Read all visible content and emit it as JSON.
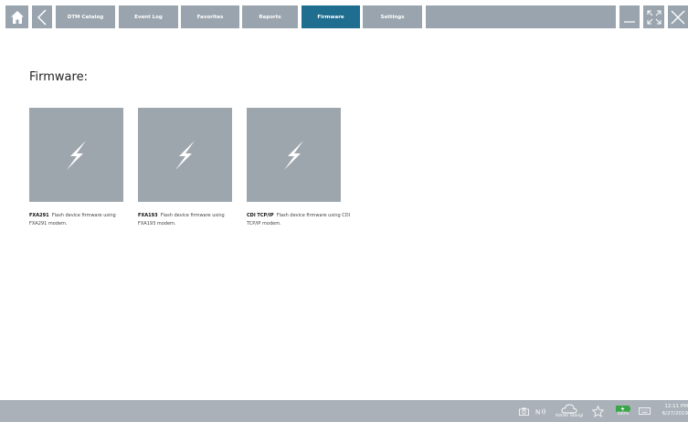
{
  "toolbar": {
    "home_icon": "home-icon",
    "back_icon": "chevron-left-icon",
    "tabs": [
      {
        "label": "DTM Catalog",
        "active": false
      },
      {
        "label": "Event Log",
        "active": false
      },
      {
        "label": "Favorites",
        "active": false
      },
      {
        "label": "Reports",
        "active": false
      },
      {
        "label": "Firmware",
        "active": true
      },
      {
        "label": "Settings",
        "active": false
      }
    ],
    "window_controls": [
      "minimize-icon",
      "maximize-icon",
      "close-icon"
    ]
  },
  "main": {
    "title": "Firmware:",
    "items": [
      {
        "name": "FXA291",
        "description": "Flash device firmware using FXA291 modem.",
        "icon": "lightning-icon"
      },
      {
        "name": "FXA193",
        "description": "Flash device firmware using FXA193 modem.",
        "icon": "lightning-icon"
      },
      {
        "name": "CDI TCP/IP",
        "description": "Flash device firmware using CDI TCP/IP modem.",
        "icon": "lightning-icon"
      }
    ]
  },
  "taskbar": {
    "user": "Adrian Stangl",
    "battery": "100%",
    "time": "12:11 PM",
    "date": "6/27/2019",
    "accent": "#1f6d8f"
  }
}
